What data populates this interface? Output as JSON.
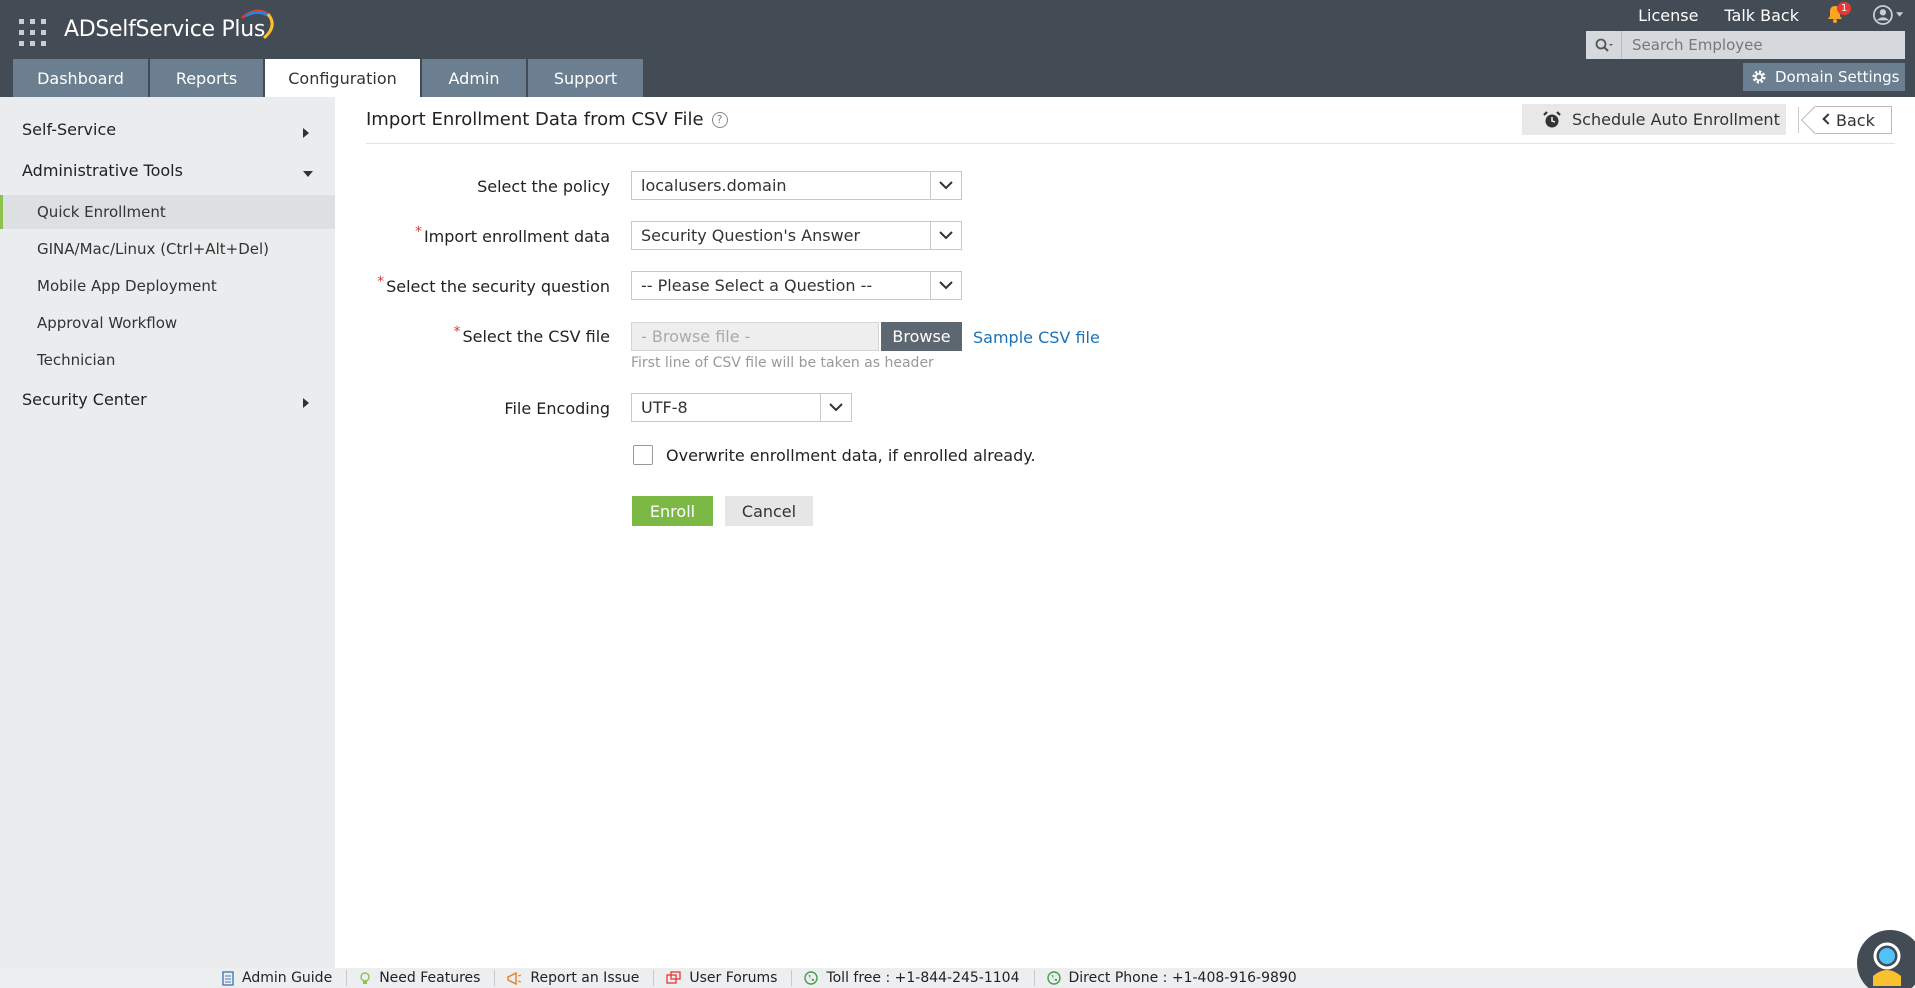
{
  "header": {
    "logo_text": "ADSelfService Plus",
    "links": {
      "license": "License",
      "talk_back": "Talk Back"
    },
    "notification_count": "1",
    "search_placeholder": "Search Employee",
    "tabs": [
      {
        "label": "Dashboard"
      },
      {
        "label": "Reports"
      },
      {
        "label": "Configuration"
      },
      {
        "label": "Admin"
      },
      {
        "label": "Support"
      }
    ],
    "domain_settings": "Domain Settings"
  },
  "sidebar": {
    "self_service": "Self-Service",
    "administrative_tools": "Administrative Tools",
    "items": [
      {
        "label": "Quick Enrollment"
      },
      {
        "label": "GINA/Mac/Linux (Ctrl+Alt+Del)"
      },
      {
        "label": "Mobile App Deployment"
      },
      {
        "label": "Approval Workflow"
      },
      {
        "label": "Technician"
      }
    ],
    "security_center": "Security Center"
  },
  "page": {
    "title": "Import Enrollment Data from CSV File",
    "help": "?",
    "schedule_button": "Schedule Auto Enrollment",
    "back_button": "Back"
  },
  "form": {
    "policy_label": "Select the policy",
    "policy_value": "localusers.domain",
    "import_label": "Import enrollment data",
    "import_value": "Security Question's Answer",
    "question_label": "Select the security question",
    "question_value": "-- Please Select a Question --",
    "csv_label": "Select the CSV file",
    "csv_placeholder": "- Browse file -",
    "browse_button": "Browse",
    "sample_link": "Sample CSV file",
    "csv_hint": "First line of CSV file will be taken as header",
    "encoding_label": "File Encoding",
    "encoding_value": "UTF-8",
    "overwrite_label": "Overwrite enrollment data, if enrolled already.",
    "enroll_button": "Enroll",
    "cancel_button": "Cancel"
  },
  "footer": {
    "admin_guide": "Admin Guide",
    "need_features": "Need Features",
    "report_issue": "Report an Issue",
    "user_forums": "User Forums",
    "toll_free": "Toll free : +1-844-245-1104",
    "direct_phone": "Direct Phone : +1-408-916-9890"
  },
  "colors": {
    "header_bg": "#434b55",
    "tab_bg": "#6b7f90",
    "accent_green": "#7cb944",
    "link_blue": "#1a73b8"
  }
}
